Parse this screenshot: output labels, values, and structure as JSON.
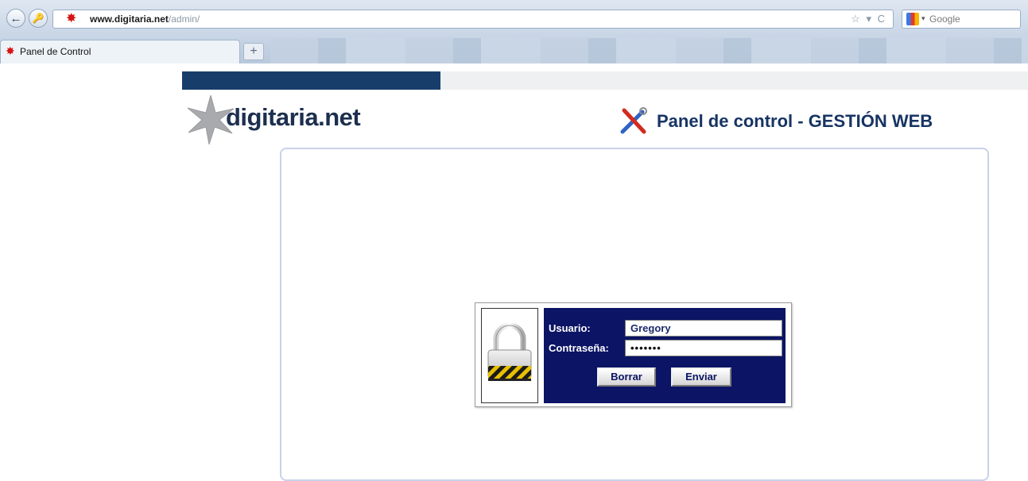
{
  "browser": {
    "url_domain": "www.digitaria.net",
    "url_path": "/admin/",
    "url_right_icons": "☆ ▾ C",
    "search_placeholder": "Google",
    "tab_title": "Panel de Control",
    "new_tab_label": "+"
  },
  "page": {
    "progress_fraction": 0.305,
    "logo_text": "digitaria.net",
    "panel_title": "Panel de control - GESTIÓN WEB",
    "colors": {
      "navy": "#0b1465",
      "header_blue": "#173463",
      "progress": "#173e6b"
    }
  },
  "login": {
    "user_label": "Usuario:",
    "user_value": "Gregory",
    "password_label": "Contraseña:",
    "password_value": "•••••••",
    "reset_button": "Borrar",
    "submit_button": "Enviar",
    "icon": "padlock-icon"
  }
}
